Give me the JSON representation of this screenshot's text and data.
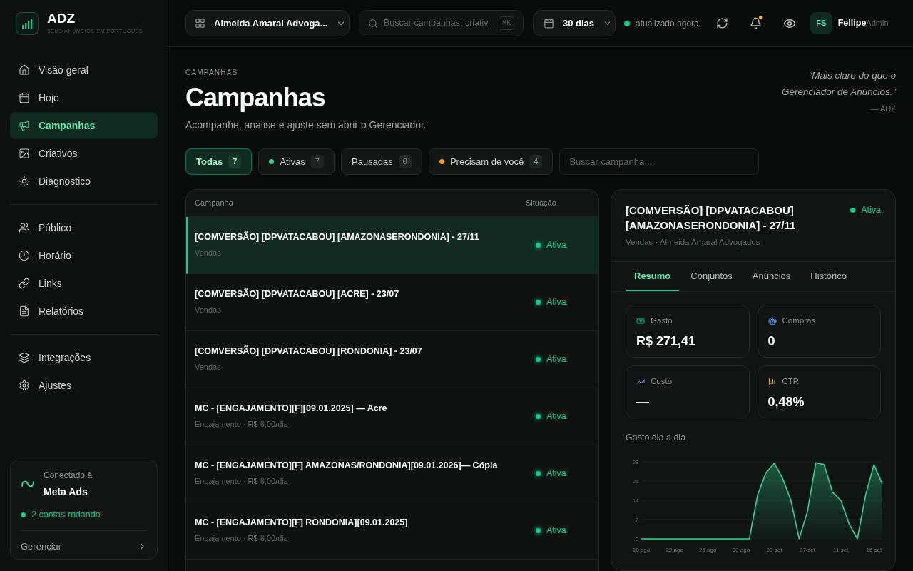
{
  "brand": {
    "name": "ADZ",
    "tagline": "SEUS ANÚNCIOS EM PORTUGUÊS"
  },
  "sidebar": {
    "sections": [
      {
        "items": [
          {
            "label": "Visão geral",
            "selected": false
          },
          {
            "label": "Hoje",
            "selected": false
          },
          {
            "label": "Campanhas",
            "selected": true
          },
          {
            "label": "Criativos",
            "selected": false
          },
          {
            "label": "Diagnóstico",
            "selected": false
          }
        ]
      },
      {
        "items": [
          {
            "label": "Público",
            "selected": false
          },
          {
            "label": "Horário",
            "selected": false
          },
          {
            "label": "Links",
            "selected": false
          },
          {
            "label": "Relatórios",
            "selected": false
          }
        ]
      },
      {
        "items": [
          {
            "label": "Integrações",
            "selected": false
          },
          {
            "label": "Ajustes",
            "selected": false
          }
        ]
      }
    ],
    "connection": {
      "caption": "Conectado à",
      "name": "Meta Ads",
      "status": "2 contas rodando",
      "action": "Gerenciar"
    }
  },
  "topbar": {
    "account": "Almeida Amaral Advoga...",
    "search": {
      "placeholder": "Buscar campanhas, criativ",
      "shortcut": "⌘K"
    },
    "period": "30 dias",
    "sync": "atualizado agora",
    "notification": true,
    "user": {
      "initials": "FS",
      "name": "Fellipe",
      "role": "Admin"
    }
  },
  "header": {
    "eyebrow": "CAMPANHAS",
    "title": "Campanhas",
    "subtitle": "Acompanhe, analise e ajuste sem abrir o Gerenciador.",
    "quote": "“Mais claro do que o Gerenciador de Anúncios.”",
    "quote_author": "— ADZ"
  },
  "filters": [
    {
      "label": "Todas",
      "count": "7",
      "selected": true
    },
    {
      "label": "Ativas",
      "count": "7",
      "selected": false,
      "color": "#34d399"
    },
    {
      "label": "Pausadas",
      "count": "0",
      "selected": false
    },
    {
      "label": "Precisam de você",
      "count": "4",
      "selected": false,
      "color": "#f59e0b"
    }
  ],
  "filter_search": {
    "placeholder": "Buscar campanha..."
  },
  "table": {
    "columns": [
      "Campanha",
      "Situação"
    ],
    "rows": [
      {
        "name": "[COMVERSÃO] [DPVATACABOU] [AMAZONASERONDONIA] - 27/11",
        "detail": "Vendas",
        "status": "Ativa",
        "selected": true
      },
      {
        "name": "[COMVERSÃO] [DPVATACABOU] [ACRE] - 23/07",
        "detail": "Vendas",
        "status": "Ativa",
        "selected": false
      },
      {
        "name": "[COMVERSÃO] [DPVATACABOU] [RONDONIA] - 23/07",
        "detail": "Vendas",
        "status": "Ativa",
        "selected": false
      },
      {
        "name": "MC - [ENGAJAMENTO][F][09.01.2025] — Acre",
        "detail": "Engajamento · R$ 6,00/dia",
        "status": "Ativa",
        "selected": false
      },
      {
        "name": "MC - [ENGAJAMENTO][F] AMAZONAS/RONDONIA][09.01.2026]— Cópia",
        "detail": "Engajamento · R$ 6,00/dia",
        "status": "Ativa",
        "selected": false
      },
      {
        "name": "MC - [ENGAJAMENTO][F] RONDONIA][09.01.2025]",
        "detail": "Engajamento · R$ 6,00/dia",
        "status": "Ativa",
        "selected": false
      }
    ]
  },
  "detail": {
    "title": "[COMVERSÃO] [DPVATACABOU] [AMAZONASERONDONIA] - 27/11",
    "subtitle": "Vendas · Almeida Amaral Advogados",
    "status": "Ativa",
    "tabs": [
      {
        "label": "Resumo",
        "selected": true
      },
      {
        "label": "Conjuntos",
        "selected": false
      },
      {
        "label": "Anúncios",
        "selected": false
      },
      {
        "label": "Histórico",
        "selected": false
      }
    ],
    "metrics": [
      {
        "label": "Gasto",
        "value": "R$ 271,41"
      },
      {
        "label": "Compras",
        "value": "0"
      },
      {
        "label": "Custo",
        "value": "—"
      },
      {
        "label": "CTR",
        "value": "0,48%"
      }
    ],
    "chart_title": "Gasto dia a dia",
    "chart_data": {
      "type": "area",
      "categories": [
        "18 ago",
        null,
        null,
        null,
        "22 ago",
        null,
        null,
        null,
        "26 ago",
        null,
        null,
        null,
        "30 ago",
        null,
        null,
        null,
        "03 set",
        null,
        null,
        null,
        "07 set",
        null,
        null,
        null,
        "11 set",
        null,
        null,
        null,
        "15 set",
        null
      ],
      "series": [
        {
          "color": "#34d399",
          "values": [
            0,
            0,
            0,
            0,
            0,
            0,
            0,
            0,
            0,
            0,
            0,
            0,
            0,
            0,
            16,
            24,
            27.5,
            22,
            14,
            0,
            10,
            27.7,
            27,
            17,
            14,
            5.5,
            0,
            16,
            27,
            20
          ]
        }
      ],
      "ylim": [
        0,
        28
      ],
      "grid": true,
      "yticks": [
        0,
        7,
        14,
        21,
        28
      ]
    }
  }
}
